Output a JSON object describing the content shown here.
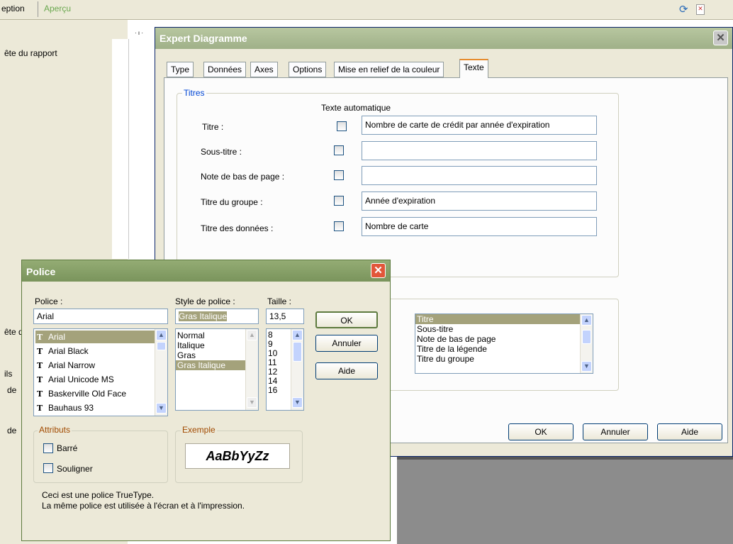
{
  "topbar": {
    "tab_conception": "eption",
    "tab_apercu": "Aperçu"
  },
  "left_panel": {
    "rapport_header": "ête du rapport",
    "entete2": "ête d",
    "ils": "ils",
    "de1": "de",
    "de2": "de"
  },
  "ruler": {
    "marks": "· ı ·"
  },
  "expert": {
    "title": "Expert Diagramme",
    "close": "✕",
    "tabs": [
      "Type",
      "Données",
      "Axes",
      "Options",
      "Mise en relief de la couleur",
      "Texte"
    ],
    "titres_group": "Titres",
    "auto_text_header": "Texte automatique",
    "rows": [
      {
        "label": "Titre :",
        "value": "Nombre de carte de crédit par année d'expiration"
      },
      {
        "label": "Sous-titre :",
        "value": ""
      },
      {
        "label": "Note de bas de page :",
        "value": ""
      },
      {
        "label": "Titre du groupe :",
        "value": "Année d'expiration"
      },
      {
        "label": "Titre des données :",
        "value": "Nombre de carte"
      }
    ],
    "format_list": [
      "Titre",
      "Sous-titre",
      "Note de bas de page",
      "Titre de la légende",
      "Titre du groupe"
    ],
    "btn_ok": "OK",
    "btn_annuler": "Annuler",
    "btn_aide": "Aide"
  },
  "police": {
    "title": "Police",
    "close": "✕",
    "police_label": "Police :",
    "police_value": "Arial",
    "fonts": [
      "Arial",
      "Arial Black",
      "Arial Narrow",
      "Arial Unicode MS",
      "Baskerville Old Face",
      "Bauhaus 93"
    ],
    "style_label": "Style de police :",
    "style_value": "Gras Italique",
    "styles": [
      "Normal",
      "Italique",
      "Gras",
      "Gras Italique"
    ],
    "taille_label": "Taille :",
    "taille_value": "13,5",
    "sizes": [
      "8",
      "9",
      "10",
      "11",
      "12",
      "14",
      "16"
    ],
    "btn_ok": "OK",
    "btn_annuler": "Annuler",
    "btn_aide": "Aide",
    "attributs_label": "Attributs",
    "barre": "Barré",
    "souligner": "Souligner",
    "exemple_label": "Exemple",
    "exemple_text": "AaBbYyZz",
    "info_line1": "Ceci est une police TrueType.",
    "info_line2": "La même police est utilisée à l'écran et à l'impression.",
    "font_icon": "T"
  }
}
